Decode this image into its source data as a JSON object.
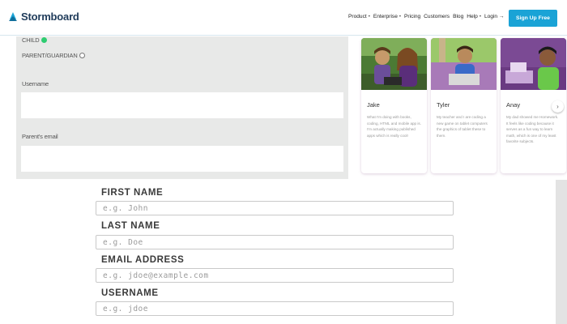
{
  "header": {
    "logo_text": "Stormboard",
    "nav": {
      "product": "Product",
      "enterprise": "Enterprise",
      "pricing": "Pricing",
      "customers": "Customers",
      "blog": "Blog",
      "help": "Help",
      "login": "Login →"
    },
    "signup_label": "Sign Up Free",
    "accent_color": "#1aa3d6"
  },
  "signup_panel": {
    "role_child": "CHILD",
    "role_parent": "PARENT/GUARDIAN",
    "selected_role": "CHILD",
    "username_label": "Username",
    "parent_email_label": "Parent's email",
    "username_value": "",
    "parent_email_value": ""
  },
  "testimonials": [
    {
      "name": "Jake",
      "description": "What I'm doing with books, coding, HTML and mobile app is. I'm actually making published apps which is really cool!"
    },
    {
      "name": "Tyler",
      "description": "My teacher and I are coding a new game on tablet computers the graphics of tablet these to them."
    },
    {
      "name": "Anay",
      "description": "My dad showed me Homework. It feels like coding because it serves as a fun way to learn math, which is one of my least favorite subjects."
    }
  ],
  "form": {
    "first_name_label": "FIRST NAME",
    "first_name_placeholder": "e.g. John",
    "last_name_label": "LAST NAME",
    "last_name_placeholder": "e.g. Doe",
    "email_label": "EMAIL ADDRESS",
    "email_placeholder": "e.g. jdoe@example.com",
    "username_label": "USERNAME",
    "username_placeholder": "e.g. jdoe"
  },
  "icons": {
    "carousel_next": "chevron-right-icon",
    "logo": "stormboard-logo-icon"
  }
}
